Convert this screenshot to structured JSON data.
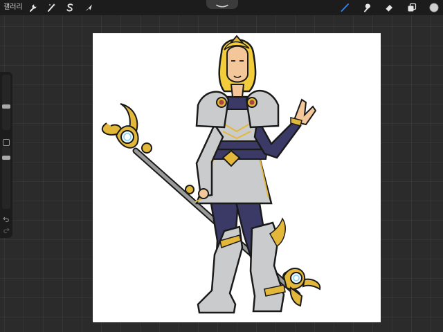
{
  "toolbar": {
    "gallery_label": "갤러리",
    "left_tools": [
      {
        "name": "actions",
        "icon": "wrench-icon"
      },
      {
        "name": "adjustments",
        "icon": "magic-wand-icon"
      },
      {
        "name": "selection",
        "icon": "selection-s-icon"
      },
      {
        "name": "transform",
        "icon": "cursor-arrow-icon"
      }
    ],
    "right_tools": [
      {
        "name": "brush",
        "icon": "brush-icon",
        "active": true
      },
      {
        "name": "smudge",
        "icon": "smudge-icon",
        "active": false
      },
      {
        "name": "eraser",
        "icon": "eraser-icon",
        "active": false
      },
      {
        "name": "layers",
        "icon": "layers-icon",
        "active": false
      },
      {
        "name": "color",
        "icon": "color-swatch-icon",
        "active": false
      }
    ],
    "accent_color": "#2f86ff",
    "current_color": "#cfcfcf"
  },
  "sidebar": {
    "brush_size": 0.65,
    "opacity": 0.88,
    "tools": [
      "brush-size-slider",
      "modify-button",
      "opacity-slider",
      "undo-button",
      "redo-button"
    ]
  },
  "canvas": {
    "background": "#ffffff",
    "subject": "character-illustration"
  }
}
